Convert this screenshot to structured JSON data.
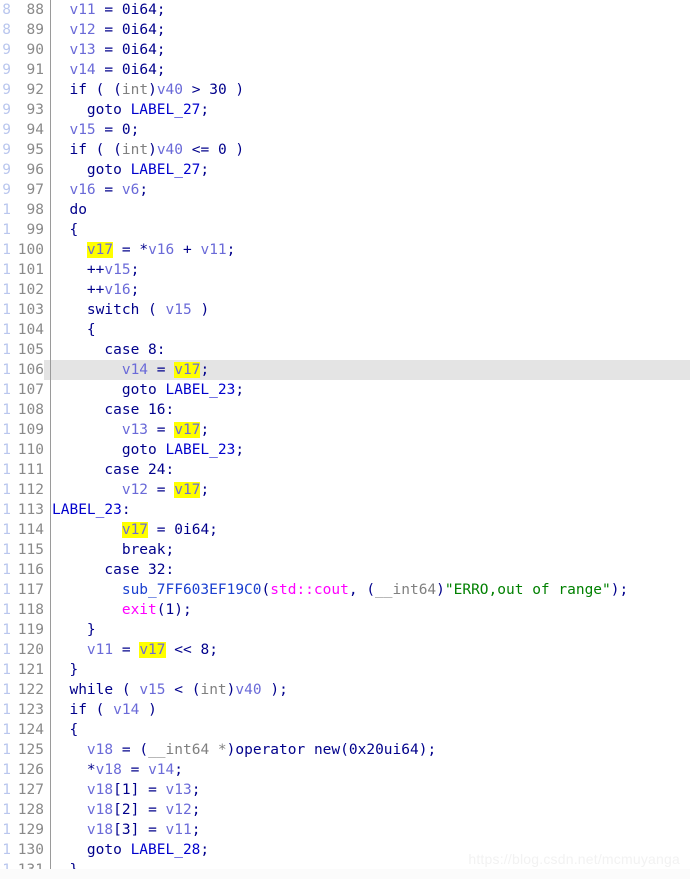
{
  "editor": {
    "name": "hex-rays-decompiler-pseudocode",
    "language": "C++ pseudocode",
    "first_line": 88,
    "last_line": 131,
    "current_line": 106,
    "highlighted_identifier": "v17",
    "colors": {
      "background": "#ffffff",
      "line_number": "#8a8a8a",
      "gutter_separator": "#9a9a9a",
      "current_line_background": "#e4e4e4",
      "variable": "#6a6ad8",
      "keyword": "#00008b",
      "cast_type": "#808080",
      "function": "#1a3fd0",
      "macro_stdlib": "#ff00ff",
      "string": "#008000",
      "label": "#0000cd",
      "highlight": "#ffff00"
    }
  },
  "lines": [
    {
      "n": "88",
      "text": "  v11 = 0i64;"
    },
    {
      "n": "89",
      "text": "  v12 = 0i64;"
    },
    {
      "n": "90",
      "text": "  v13 = 0i64;"
    },
    {
      "n": "91",
      "text": "  v14 = 0i64;"
    },
    {
      "n": "92",
      "text": "  if ( (int)v40 > 30 )"
    },
    {
      "n": "93",
      "text": "    goto LABEL_27;"
    },
    {
      "n": "94",
      "text": "  v15 = 0;"
    },
    {
      "n": "95",
      "text": "  if ( (int)v40 <= 0 )"
    },
    {
      "n": "96",
      "text": "    goto LABEL_27;"
    },
    {
      "n": "97",
      "text": "  v16 = v6;"
    },
    {
      "n": "98",
      "text": "  do"
    },
    {
      "n": "99",
      "text": "  {"
    },
    {
      "n": "100",
      "text": "    v17 = *v16 + v11;"
    },
    {
      "n": "101",
      "text": "    ++v15;"
    },
    {
      "n": "102",
      "text": "    ++v16;"
    },
    {
      "n": "103",
      "text": "    switch ( v15 )"
    },
    {
      "n": "104",
      "text": "    {"
    },
    {
      "n": "105",
      "text": "      case 8:"
    },
    {
      "n": "106",
      "text": "        v14 = v17;"
    },
    {
      "n": "107",
      "text": "        goto LABEL_23;"
    },
    {
      "n": "108",
      "text": "      case 16:"
    },
    {
      "n": "109",
      "text": "        v13 = v17;"
    },
    {
      "n": "110",
      "text": "        goto LABEL_23;"
    },
    {
      "n": "111",
      "text": "      case 24:"
    },
    {
      "n": "112",
      "text": "        v12 = v17;"
    },
    {
      "n": "113",
      "text": "LABEL_23:"
    },
    {
      "n": "114",
      "text": "        v17 = 0i64;"
    },
    {
      "n": "115",
      "text": "        break;"
    },
    {
      "n": "116",
      "text": "      case 32:"
    },
    {
      "n": "117",
      "text": "        sub_7FF603EF19C0(std::cout, (__int64)\"ERRO,out of range\");"
    },
    {
      "n": "118",
      "text": "        exit(1);"
    },
    {
      "n": "119",
      "text": "    }"
    },
    {
      "n": "120",
      "text": "    v11 = v17 << 8;"
    },
    {
      "n": "121",
      "text": "  }"
    },
    {
      "n": "122",
      "text": "  while ( v15 < (int)v40 );"
    },
    {
      "n": "123",
      "text": "  if ( v14 )"
    },
    {
      "n": "124",
      "text": "  {"
    },
    {
      "n": "125",
      "text": "    v18 = (__int64 *)operator new(0x20ui64);"
    },
    {
      "n": "126",
      "text": "    *v18 = v14;"
    },
    {
      "n": "127",
      "text": "    v18[1] = v13;"
    },
    {
      "n": "128",
      "text": "    v18[2] = v12;"
    },
    {
      "n": "129",
      "text": "    v18[3] = v11;"
    },
    {
      "n": "130",
      "text": "    goto LABEL_28;"
    },
    {
      "n": "131",
      "text": "  }"
    }
  ],
  "edge_strip_digits": [
    "8",
    "8",
    "9",
    "9",
    "9",
    "9",
    "9",
    "9",
    "9",
    "9",
    "1",
    "1",
    "1",
    "1",
    "1",
    "1",
    "1",
    "1",
    "1",
    "1",
    "1",
    "1",
    "1",
    "1",
    "1",
    "1",
    "1",
    "1",
    "1",
    "1",
    "1",
    "1",
    "1",
    "1",
    "1",
    "1",
    "1",
    "1",
    "1",
    "1",
    "1",
    "1",
    "1",
    "1"
  ],
  "watermark": {
    "text": "https://blog.csdn.net/mcmuyanga"
  }
}
